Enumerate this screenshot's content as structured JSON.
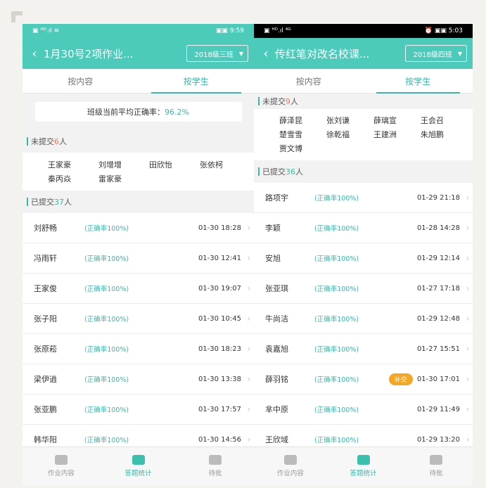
{
  "left": {
    "statusbar": {
      "left": "▣ ᴴᴰ.ıl ≋",
      "right": "▣▣ 9:59"
    },
    "title": "1月30号2项作业...",
    "class_select": "2018级三班",
    "tabs": [
      "按内容",
      "按学生"
    ],
    "avg": {
      "label": "班级当前平均正确率：",
      "value": "96.2%"
    },
    "unsubmitted": {
      "prefix": "未提交",
      "count": "6",
      "suffix": "人",
      "names": [
        "王家豪",
        "刘增增",
        "田欣怡",
        "张依柯",
        "秦丙焱",
        "雷家豪"
      ]
    },
    "submitted": {
      "prefix": "已提交",
      "count": "37",
      "suffix": "人"
    },
    "rows": [
      {
        "name": "刘舒畅",
        "acc": "(正确率100%)",
        "time": "01-30 18:28"
      },
      {
        "name": "冯雨轩",
        "acc": "(正确率100%)",
        "time": "01-30 12:41"
      },
      {
        "name": "王家俊",
        "acc": "(正确率100%)",
        "time": "01-30 19:07"
      },
      {
        "name": "张子阳",
        "acc": "(正确率100%)",
        "time": "01-30 10:45"
      },
      {
        "name": "张原菘",
        "acc": "(正确率100%)",
        "time": "01-30 18:23"
      },
      {
        "name": "梁伊逍",
        "acc": "(正确率100%)",
        "time": "01-30 13:38"
      },
      {
        "name": "张亚鹏",
        "acc": "(正确率100%)",
        "time": "01-30 17:57"
      },
      {
        "name": "韩华阳",
        "acc": "(正确率100%)",
        "time": "01-30 14:56"
      }
    ],
    "nav": [
      "作业内容",
      "答题统计",
      "待批"
    ]
  },
  "right": {
    "statusbar": {
      "left": "▣ ᴴᴰ.ıl ⁴ᴳ",
      "right": "⏰ ▣▣ 5:03"
    },
    "title": "传红笔对改名校课...",
    "class_select": "2018级四班",
    "tabs": [
      "按内容",
      "按学生"
    ],
    "unsubmitted": {
      "prefix": "未提交",
      "count": "9",
      "suffix": "人",
      "names": [
        "薛泽昆",
        "张刘谦",
        "薛璃宣",
        "王会召",
        "楚雪雪",
        "徐乾福",
        "王建洲",
        "朱旭鹏",
        "贾文博"
      ]
    },
    "submitted": {
      "prefix": "已提交",
      "count": "36",
      "suffix": "人"
    },
    "rows": [
      {
        "name": "路项宇",
        "acc": "(正确率100%)",
        "time": "01-29 21:18",
        "badge": ""
      },
      {
        "name": "李颖",
        "acc": "(正确率100%)",
        "time": "01-28 14:28",
        "badge": ""
      },
      {
        "name": "安旭",
        "acc": "(正确率100%)",
        "time": "01-29 12:14",
        "badge": ""
      },
      {
        "name": "张亚琪",
        "acc": "(正确率100%)",
        "time": "01-27 17:18",
        "badge": ""
      },
      {
        "name": "牛尚洁",
        "acc": "(正确率100%)",
        "time": "01-29 12:48",
        "badge": ""
      },
      {
        "name": "袁嘉旭",
        "acc": "(正确率100%)",
        "time": "01-27 15:51",
        "badge": ""
      },
      {
        "name": "薛羽铭",
        "acc": "(正确率100%)",
        "time": "01-30 17:01",
        "badge": "补交"
      },
      {
        "name": "芈中原",
        "acc": "(正确率100%)",
        "time": "01-29 11:49",
        "badge": ""
      },
      {
        "name": "王欣域",
        "acc": "(正确率100%)",
        "time": "01-29 13:20",
        "badge": ""
      }
    ],
    "nav": [
      "作业内容",
      "答题统计",
      "待批"
    ]
  },
  "colors": {
    "accent": "#4ccbbb",
    "accent_text": "#39b7a7",
    "badge": "#f5a623",
    "count_red": "#f07b5c"
  },
  "icons": {
    "back": "back-arrow-icon",
    "caret": "caret-down-icon",
    "chevron": "chevron-right-icon"
  }
}
